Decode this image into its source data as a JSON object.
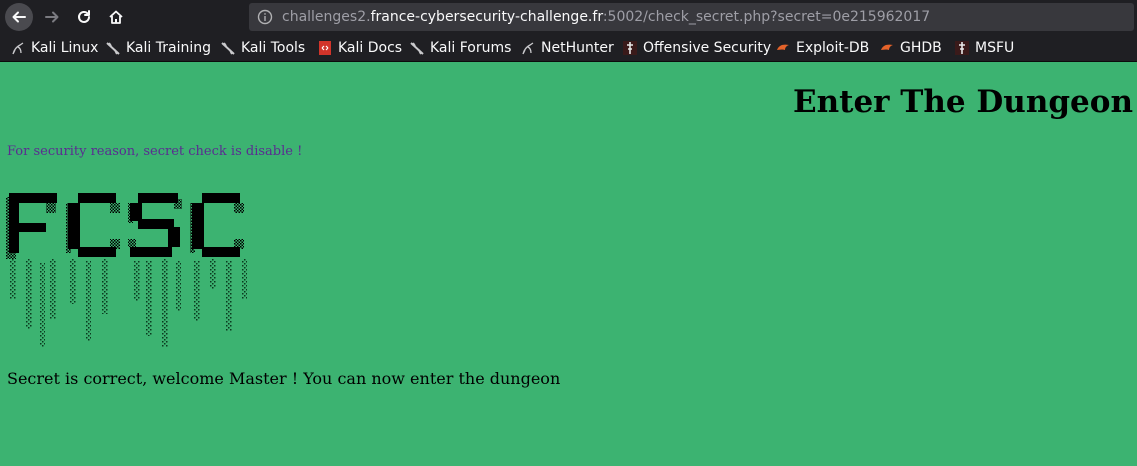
{
  "browser": {
    "url_prefix": "challenges2.",
    "url_domain": "france-cybersecurity-challenge.fr",
    "url_suffix": ":5002/check_secret.php?secret=0e215962017"
  },
  "bookmarks": [
    {
      "label": "Kali Linux",
      "icon": "kali-dragon-icon"
    },
    {
      "label": "Kali Training",
      "icon": "kali-dragon-icon"
    },
    {
      "label": "Kali Tools",
      "icon": "kali-dragon-icon"
    },
    {
      "label": "Kali Docs",
      "icon": "kali-docs-icon"
    },
    {
      "label": "Kali Forums",
      "icon": "kali-dragon-icon"
    },
    {
      "label": "NetHunter",
      "icon": "kali-dragon-icon"
    },
    {
      "label": "Offensive Security",
      "icon": "offsec-icon"
    },
    {
      "label": "Exploit-DB",
      "icon": "exploit-db-icon"
    },
    {
      "label": "GHDB",
      "icon": "exploit-db-icon"
    },
    {
      "label": "MSFU",
      "icon": "offsec-icon"
    }
  ],
  "page": {
    "title": "Enter The Dungeon",
    "notice": "For security reason, secret check is disable !",
    "logo_text": "FCSC",
    "message": "Secret is correct, welcome Master ! You can now enter the dungeon"
  },
  "colors": {
    "page_background": "#3cb371",
    "notice_text": "#5a2d91",
    "chrome_background": "#1f1f23"
  }
}
